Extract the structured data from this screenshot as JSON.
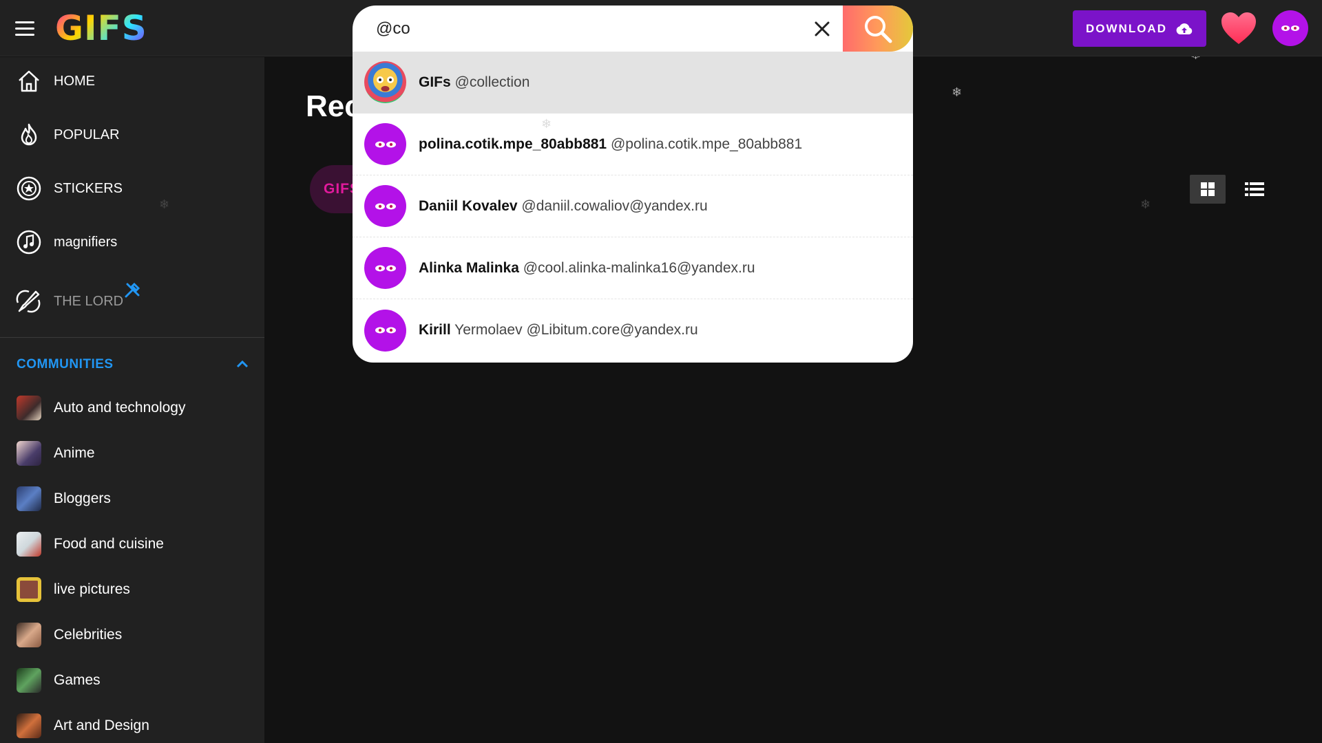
{
  "header": {
    "logo_text": "GIFS",
    "search_value": "@co",
    "download_label": "DOWNLOAD"
  },
  "sidebar": {
    "nav": [
      {
        "label": "HOME",
        "icon": "home-icon"
      },
      {
        "label": "POPULAR",
        "icon": "flame-icon"
      },
      {
        "label": "STICKERS",
        "icon": "sticker-icon"
      },
      {
        "label": "magnifiers",
        "icon": "music-icon"
      },
      {
        "label": "THE LORD",
        "icon": "brush-icon"
      }
    ],
    "communities_label": "COMMUNITIES",
    "communities": [
      {
        "label": "Auto and technology",
        "color": "#a44e3a"
      },
      {
        "label": "Anime",
        "color": "#6a5a8a"
      },
      {
        "label": "Bloggers",
        "color": "#3c5b9a"
      },
      {
        "label": "Food and cuisine",
        "color": "#cfd8dc"
      },
      {
        "label": "live pictures",
        "color": "#e6c23a"
      },
      {
        "label": "Celebrities",
        "color": "#b88f72"
      },
      {
        "label": "Games",
        "color": "#4a7a4a"
      },
      {
        "label": "Art and Design",
        "color": "#b0502c"
      }
    ]
  },
  "main": {
    "title_partial": "Rec",
    "pill_partial": "GIFS"
  },
  "dropdown": {
    "items": [
      {
        "name": "GIFs",
        "handle": "@collection"
      },
      {
        "name": "polina.cotik.mpe_80abb881",
        "handle": "@polina.cotik.mpe_80abb881"
      },
      {
        "name": "Daniil Kovalev",
        "handle": "@daniil.cowaliov@yandex.ru"
      },
      {
        "name": "Alinka Malinka",
        "handle": "@cool.alinka-malinka16@yandex.ru"
      },
      {
        "name": "Kirill",
        "handle": "Yermolaev @Libitum.core@yandex.ru"
      }
    ]
  },
  "colors": {
    "accent_blue": "#2196f3",
    "download_purple": "#7b13c9",
    "avatar_purple": "#b312e8",
    "pill_pink": "#e11a9c"
  }
}
